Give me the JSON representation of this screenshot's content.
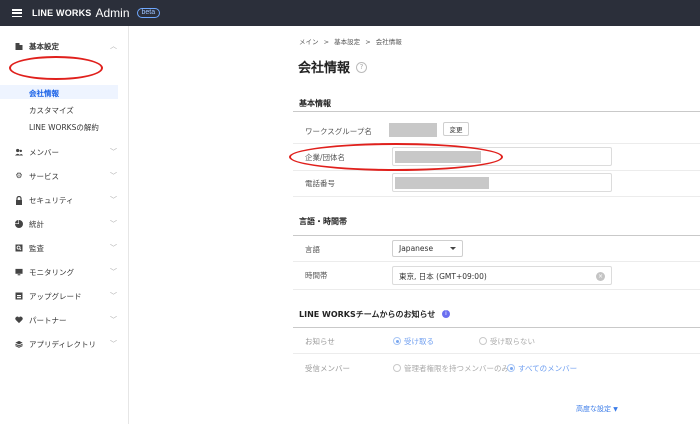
{
  "header": {
    "brand": "LINE WORKS",
    "product": "Admin",
    "badge": "beta"
  },
  "sidebar": {
    "sections": [
      {
        "label": "基本設定",
        "icon": "building-icon",
        "expanded": true,
        "children": [
          "会社情報",
          "カスタマイズ",
          "LINE WORKSの解約"
        ]
      },
      {
        "label": "メンバー",
        "icon": "members-icon"
      },
      {
        "label": "サービス",
        "icon": "gear-icon"
      },
      {
        "label": "セキュリティ",
        "icon": "lock-icon"
      },
      {
        "label": "統計",
        "icon": "pie-chart-icon"
      },
      {
        "label": "監査",
        "icon": "audit-icon"
      },
      {
        "label": "モニタリング",
        "icon": "monitor-icon"
      },
      {
        "label": "アップグレード",
        "icon": "upgrade-icon"
      },
      {
        "label": "パートナー",
        "icon": "handshake-icon"
      },
      {
        "label": "アプリディレクトリ",
        "icon": "layers-icon"
      }
    ]
  },
  "breadcrumb": [
    "メイン",
    "基本設定",
    "会社情報"
  ],
  "breadcrumb_sep": ">",
  "page_title": "会社情報",
  "basic_info": {
    "title": "基本情報",
    "workgroup_label": "ワークスグループ名",
    "change_button": "変更",
    "company_label": "企業/団体名",
    "phone_label": "電話番号"
  },
  "lang_time": {
    "title": "言語・時間帯",
    "language_label": "言語",
    "language_value": "Japanese",
    "timezone_label": "時間帯",
    "timezone_value": "東京, 日本 (GMT+09:00)"
  },
  "notice": {
    "title": "LINE WORKSチームからのお知らせ",
    "notice_label": "お知らせ",
    "receive": "受け取る",
    "not_receive": "受け取らない",
    "members_label": "受信メンバー",
    "admin_only": "管理者権限を持つメンバーのみ",
    "all_members": "すべてのメンバー"
  },
  "advanced_link": "高度な設定",
  "colors": {
    "topbar": "#2b2f3a",
    "accent": "#1a62e8",
    "annotation": "#e0201c"
  }
}
